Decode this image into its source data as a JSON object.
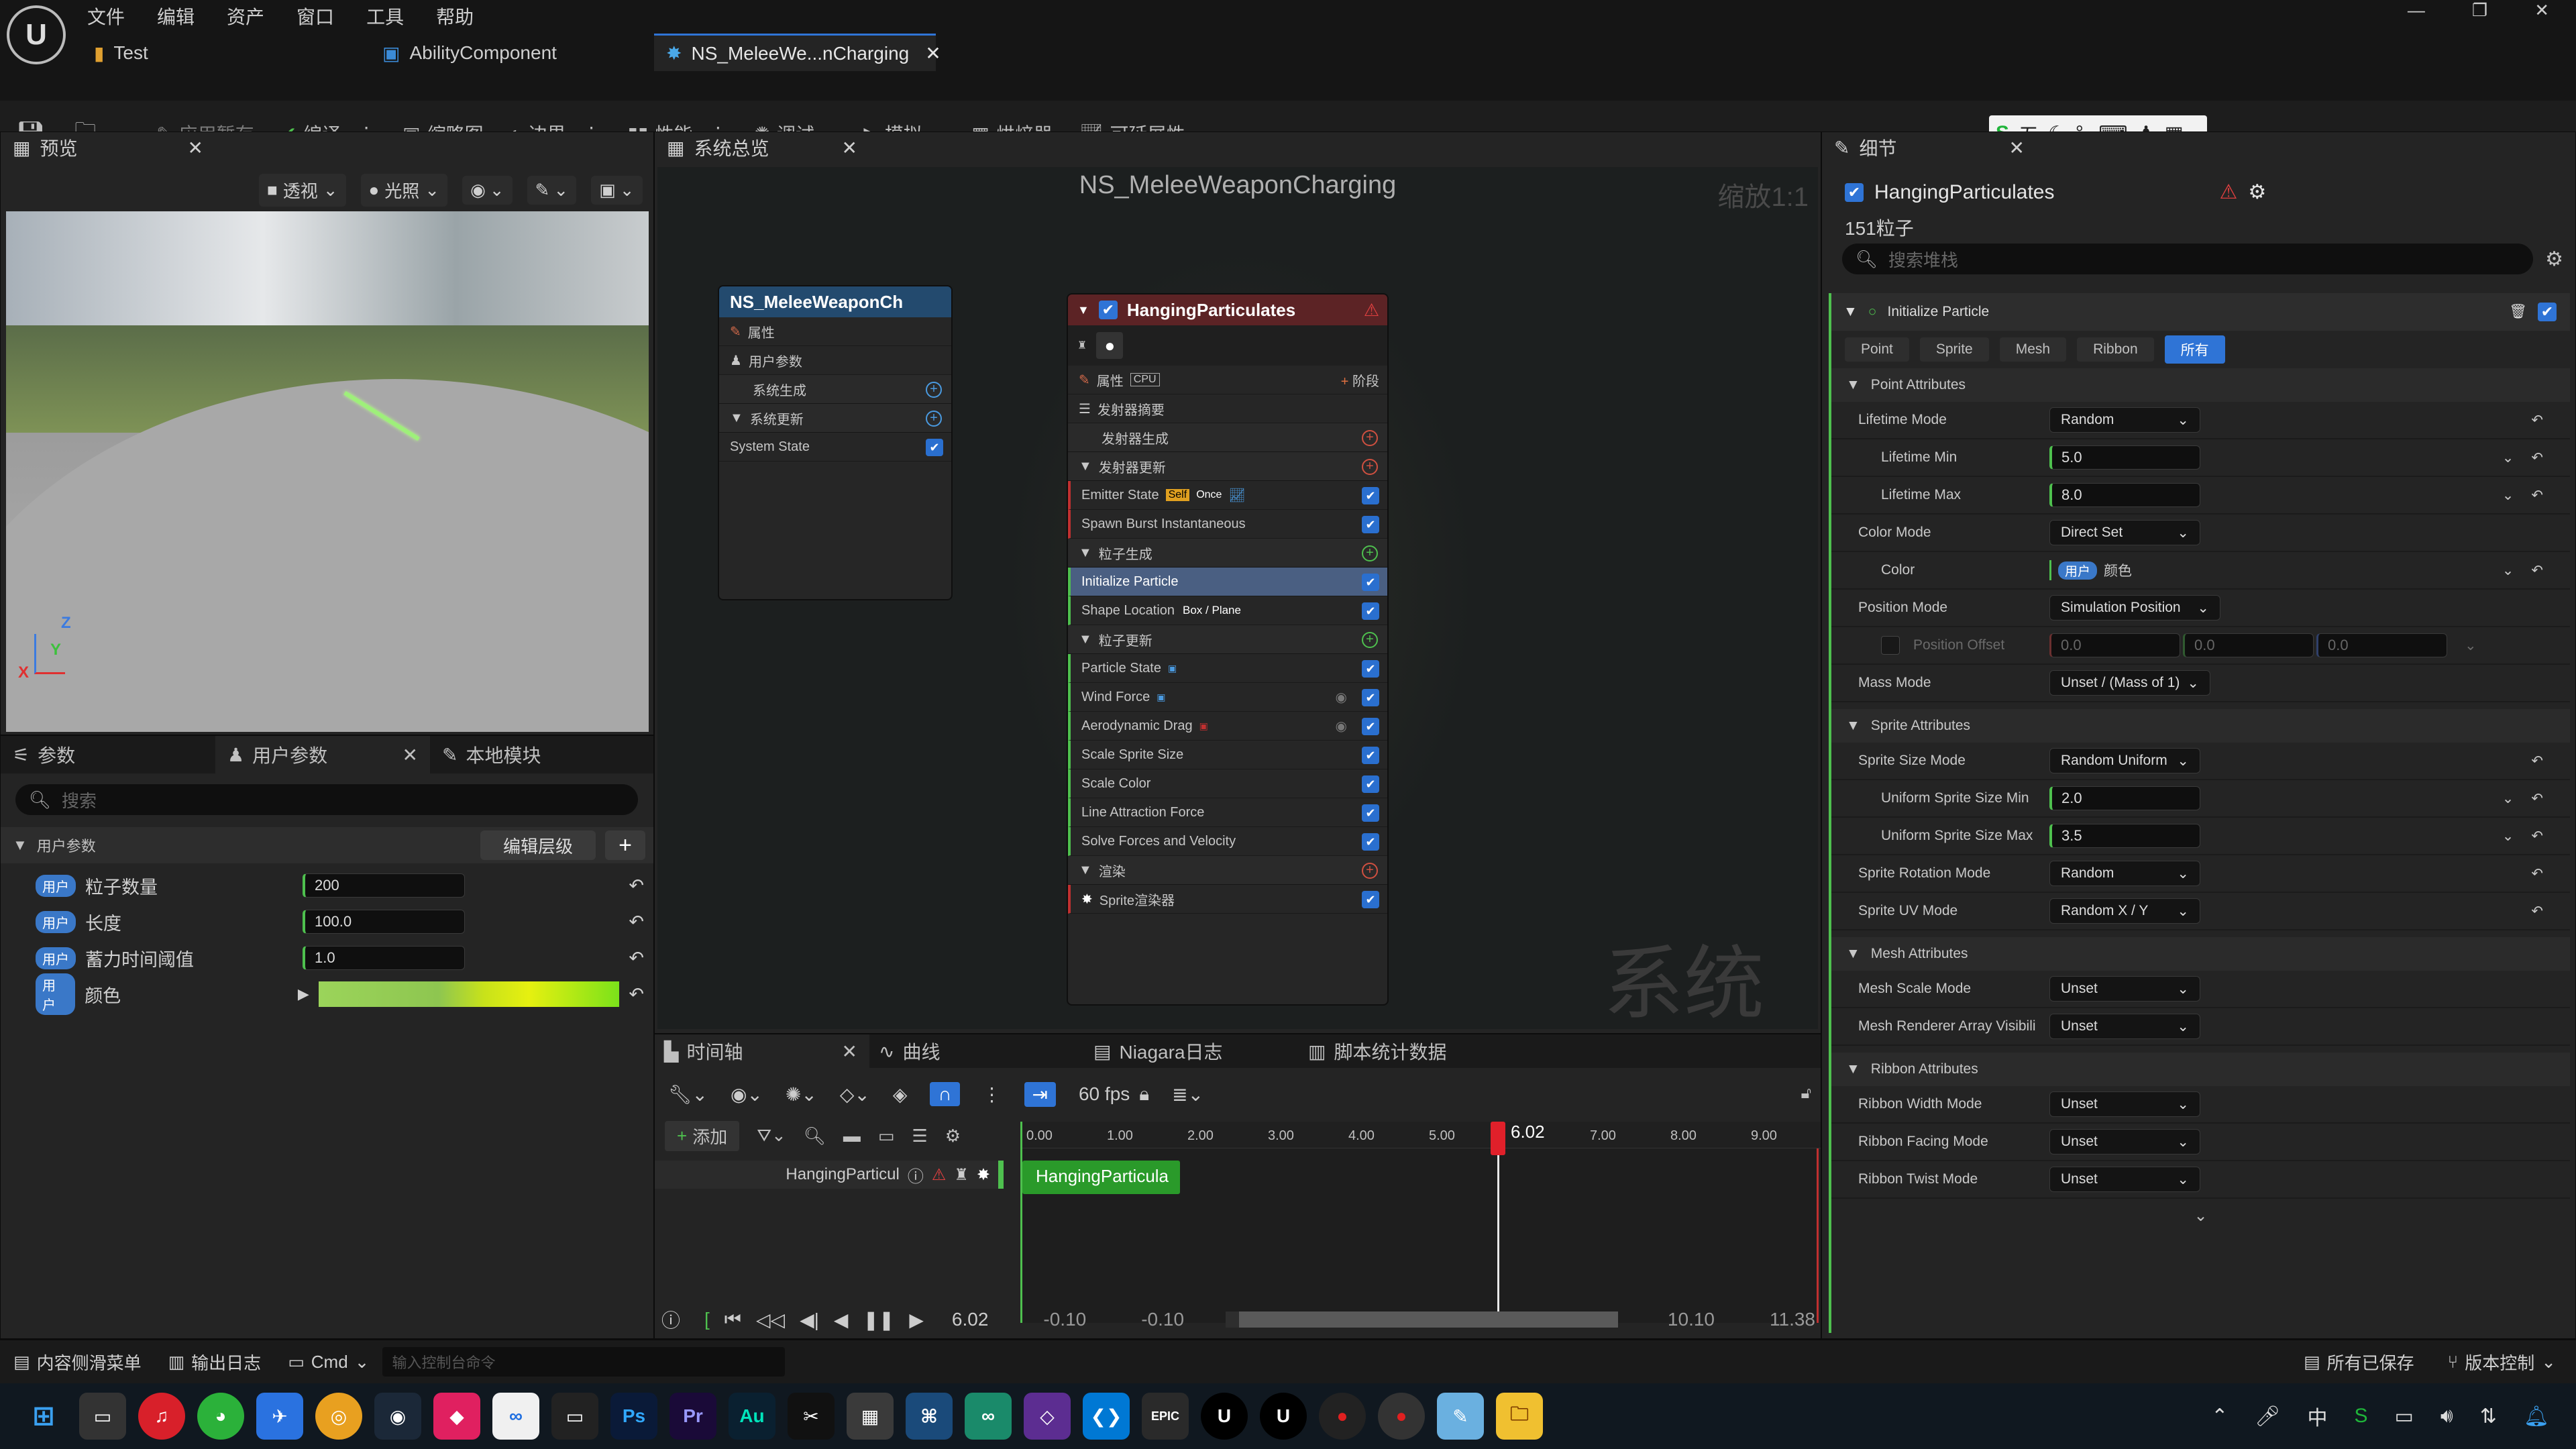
{
  "menu": {
    "items": [
      "文件",
      "编辑",
      "资产",
      "窗口",
      "工具",
      "帮助"
    ]
  },
  "tabs": {
    "t1": "Test",
    "t2": "AbilityComponent",
    "t3": "NS_MeleeWe...nCharging"
  },
  "toolbar": {
    "apply": "应用暂存",
    "compile": "编译",
    "thumbnail": "缩略图",
    "bounds": "边界",
    "perf": "性能",
    "debug": "调试",
    "simulate": "模拟",
    "baker": "烘焙器",
    "scalability": "可延展性"
  },
  "ime": {
    "label": "五"
  },
  "preview": {
    "title": "预览",
    "perspective": "透视",
    "lit": "光照"
  },
  "params": {
    "tab_params": "参数",
    "tab_user": "用户参数",
    "tab_local": "本地模块",
    "search_placeholder": "搜索",
    "section": "用户参数",
    "edit_hierarchy": "编辑层级",
    "badge": "用户",
    "rows": [
      {
        "name": "粒子数量",
        "value": "200"
      },
      {
        "name": "长度",
        "value": "100.0"
      },
      {
        "name": "蓄力时间阈值",
        "value": "1.0"
      },
      {
        "name": "颜色",
        "value": ""
      }
    ]
  },
  "system": {
    "title": "系统总览",
    "graph_title": "NS_MeleeWeaponCharging",
    "zoom": "缩放1:1",
    "watermark": "系统",
    "node1": {
      "title": "NS_MeleeWeaponCh",
      "rows": [
        "属性",
        "用户参数",
        "系统生成",
        "系统更新",
        "System State"
      ]
    },
    "emitter": {
      "title": "HangingParticulates",
      "props": "属性",
      "cpu": "CPU",
      "stage": "阶段",
      "summary": "发射器摘要",
      "spawn": "发射器生成",
      "update": "发射器更新",
      "emitter_state": "Emitter State",
      "self": "Self",
      "once": "Once",
      "spawn_burst": "Spawn Burst Instantaneous",
      "particle_spawn": "粒子生成",
      "init": "Initialize Particle",
      "shape": "Shape Location",
      "shape_tag": "Box / Plane",
      "particle_update": "粒子更新",
      "pstate": "Particle State",
      "wind": "Wind Force",
      "drag": "Aerodynamic Drag",
      "scale_size": "Scale Sprite Size",
      "scale_color": "Scale Color",
      "line": "Line Attraction Force",
      "solve": "Solve Forces and Velocity",
      "render": "渲染",
      "sprite_renderer": "Sprite渲染器"
    }
  },
  "timeline": {
    "tab_timeline": "时间轴",
    "tab_curves": "曲线",
    "tab_log": "Niagara日志",
    "tab_stats": "脚本统计数据",
    "fps": "60 fps",
    "add": "添加",
    "track": "HangingParticul",
    "clip": "HangingParticula",
    "playhead": "6.02",
    "ticks": [
      "0.00",
      "1.00",
      "2.00",
      "3.00",
      "4.00",
      "5.00",
      "7.00",
      "8.00",
      "9.00"
    ],
    "time": "6.02",
    "start_a": "-0.10",
    "start_b": "-0.10",
    "end_a": "10.10",
    "end_b": "11.38",
    "playhead_pct": 0.595
  },
  "details": {
    "title": "细节",
    "emitter": "HangingParticulates",
    "count": "151粒子",
    "search_placeholder": "搜索堆栈",
    "module": "Initialize Particle",
    "filters": [
      "Point",
      "Sprite",
      "Mesh",
      "Ribbon",
      "所有"
    ],
    "point": "Point Attributes",
    "lifetime_mode": "Lifetime Mode",
    "lifetime_mode_v": "Random",
    "lifetime_min": "Lifetime Min",
    "lifetime_min_v": "5.0",
    "lifetime_max": "Lifetime Max",
    "lifetime_max_v": "8.0",
    "color_mode": "Color Mode",
    "color_mode_v": "Direct Set",
    "color": "Color",
    "color_badge": "用户",
    "color_v": "颜色",
    "pos_mode": "Position Mode",
    "pos_mode_v": "Simulation Position",
    "pos_offset": "Position Offset",
    "pos_x": "0.0",
    "pos_y": "0.0",
    "pos_z": "0.0",
    "mass_mode": "Mass Mode",
    "mass_mode_v": "Unset / (Mass of 1)",
    "sprite": "Sprite Attributes",
    "size_mode": "Sprite Size Mode",
    "size_mode_v": "Random Uniform",
    "size_min": "Uniform Sprite Size Min",
    "size_min_v": "2.0",
    "size_max": "Uniform Sprite Size Max",
    "size_max_v": "3.5",
    "rot_mode": "Sprite Rotation Mode",
    "rot_mode_v": "Random",
    "uv_mode": "Sprite UV Mode",
    "uv_mode_v": "Random X / Y",
    "mesh": "Mesh Attributes",
    "mesh_scale": "Mesh Scale Mode",
    "mesh_scale_v": "Unset",
    "mesh_vis": "Mesh Renderer Array Visibili",
    "mesh_vis_v": "Unset",
    "ribbon": "Ribbon Attributes",
    "rib_width": "Ribbon Width Mode",
    "rib_width_v": "Unset",
    "rib_facing": "Ribbon Facing Mode",
    "rib_facing_v": "Unset",
    "rib_twist": "Ribbon Twist Mode",
    "rib_twist_v": "Unset"
  },
  "statusbar": {
    "drawer": "内容侧滑菜单",
    "output": "输出日志",
    "cmd": "Cmd",
    "console_placeholder": "输入控制台命令",
    "saved": "所有已保存",
    "vcs": "版本控制"
  },
  "tray": {
    "lang": "中"
  }
}
